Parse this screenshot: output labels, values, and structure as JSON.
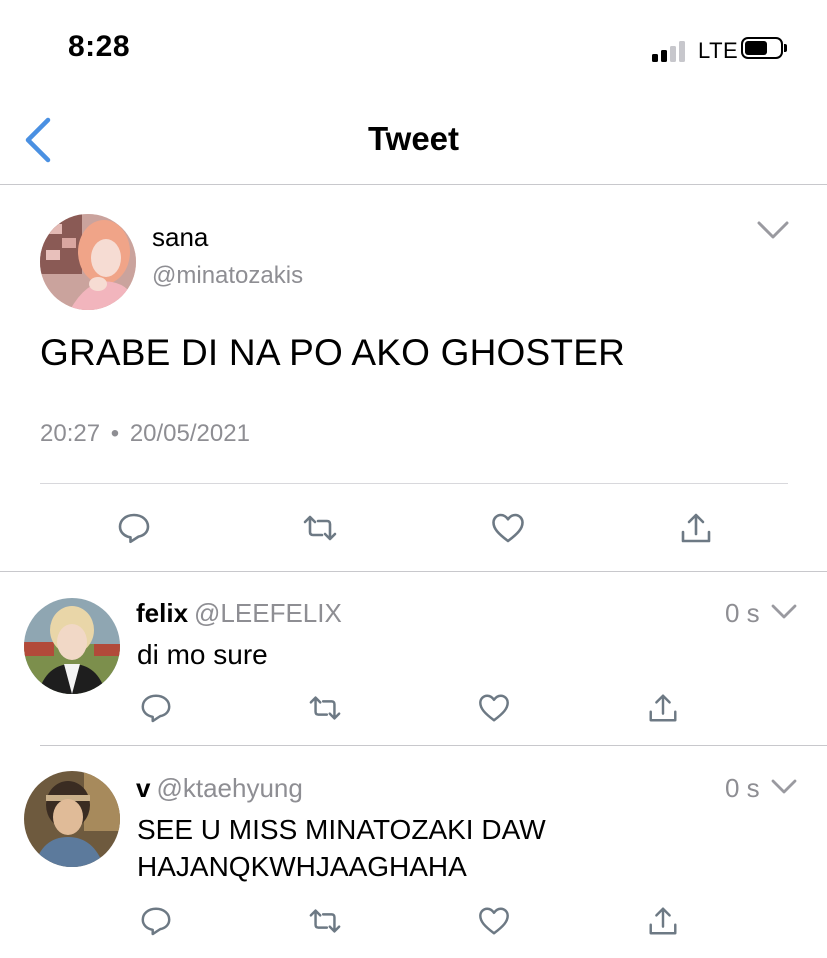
{
  "status_bar": {
    "time": "8:28",
    "network": "LTE",
    "signal_bars": 2,
    "signal_total": 4
  },
  "nav": {
    "back_icon": "chevron-left-icon",
    "title": "Tweet"
  },
  "tweet": {
    "name": "sana",
    "handle": "@minatozakis",
    "text": "GRABE DI NA PO AKO GHOSTER",
    "time": "20:27",
    "separator": "•",
    "date": "20/05/2021"
  },
  "replies": [
    {
      "name": "felix",
      "handle": "@LEEFELIX",
      "time": "0 s",
      "text_lines": [
        "di mo sure"
      ]
    },
    {
      "name": "v",
      "handle": "@ktaehyung",
      "time": "0 s",
      "text_lines": [
        "SEE U MISS MINATOZAKI DAW",
        "HAJANQKWHJAAGHAHA"
      ]
    }
  ],
  "icons": {
    "reply": "reply-icon",
    "retweet": "retweet-icon",
    "like": "heart-icon",
    "share": "share-icon",
    "more": "chevron-down-icon"
  },
  "colors": {
    "accent": "#4a90e2",
    "icon_gray": "#6d7984",
    "secondary_text": "#8e8e93",
    "divider": "#c8c8cc"
  }
}
